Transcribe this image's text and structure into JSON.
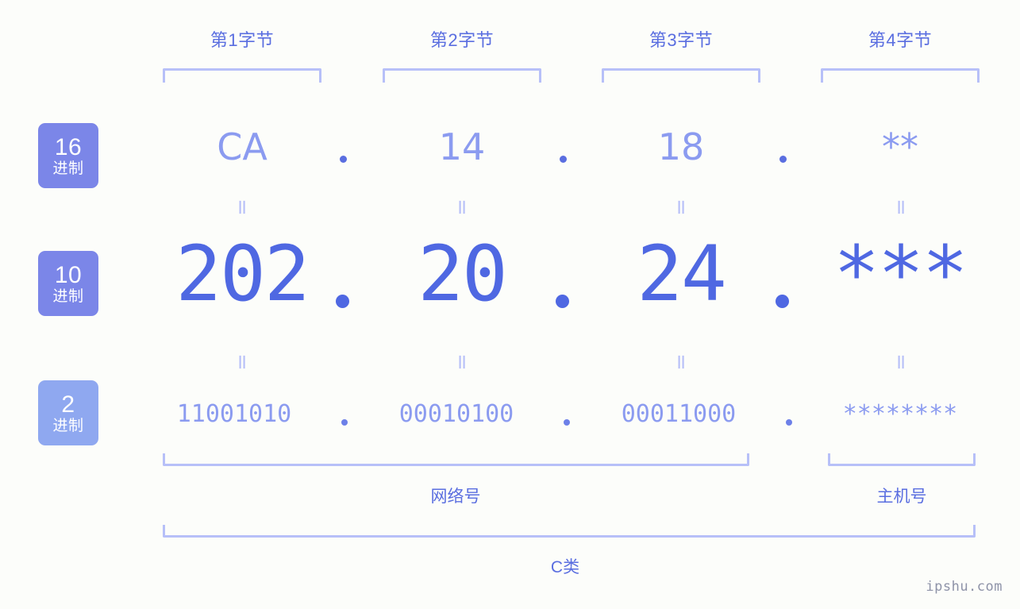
{
  "colors": {
    "background": "#fcfdfa",
    "accent_strong": "#4f68e2",
    "accent_mid": "#5a6ee0",
    "accent_light": "#8b9bf0",
    "bracket": "#b7c0f8",
    "badge_purple": "#7b86e8",
    "badge_blue": "#8fa8f0",
    "watermark": "#8e93a8"
  },
  "byte_headers": [
    {
      "label": "第1字节"
    },
    {
      "label": "第2字节"
    },
    {
      "label": "第3字节"
    },
    {
      "label": "第4字节"
    }
  ],
  "rows": [
    {
      "key": "hex",
      "badge": {
        "number": "16",
        "sub": "进制",
        "color": "#7b86e8"
      },
      "values": [
        "CA",
        "14",
        "18",
        "**"
      ],
      "separator": "."
    },
    {
      "key": "dec",
      "badge": {
        "number": "10",
        "sub": "进制",
        "color": "#7b86e8"
      },
      "values": [
        "202",
        "20",
        "24",
        "***"
      ],
      "separator": "."
    },
    {
      "key": "bin",
      "badge": {
        "number": "2",
        "sub": "进制",
        "color": "#8fa8f0"
      },
      "values": [
        "11001010",
        "00010100",
        "00011000",
        "********"
      ],
      "separator": "."
    }
  ],
  "equals_marks": {
    "symbol": "=",
    "count_per_gap": 4,
    "gaps": 2
  },
  "captions": {
    "network": "网络号",
    "host": "主机号",
    "class": "C类"
  },
  "watermark": "ipshu.com"
}
